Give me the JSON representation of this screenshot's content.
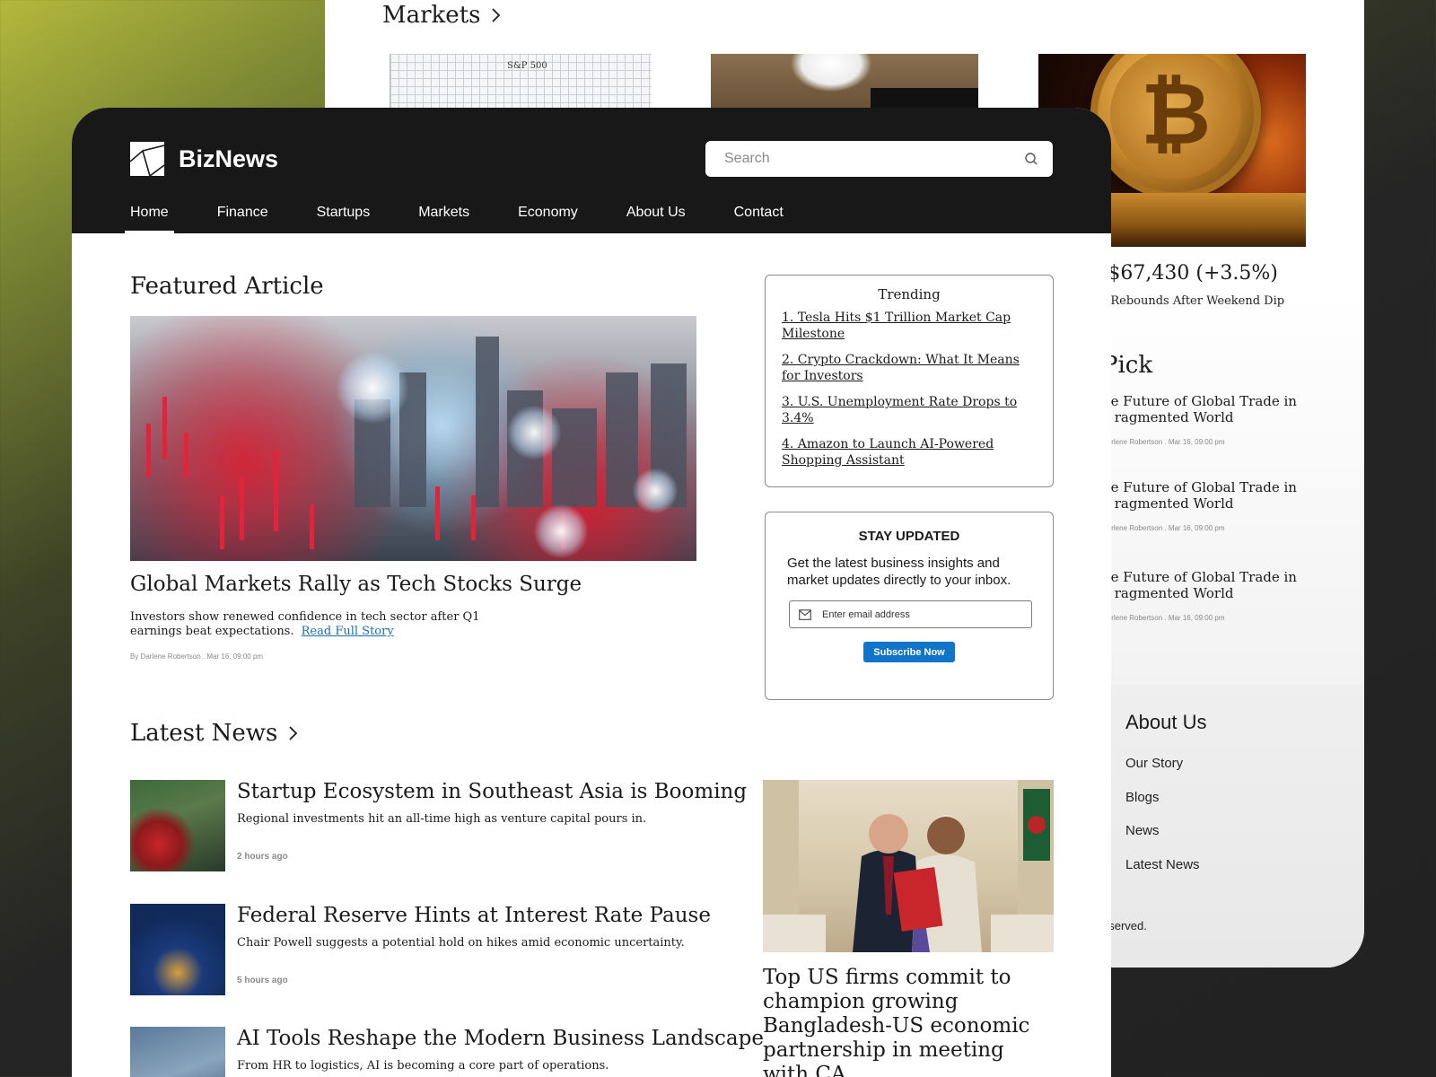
{
  "back": {
    "markets_heading": "Markets",
    "chart_label": "S&P 500",
    "price_text": ": $67,430 (+3.5%)",
    "price_sub": "t Rebounds After Weekend Dip",
    "pick_heading": "Pick",
    "picks": [
      {
        "title": "he Future of Global Trade in a ragmented World",
        "meta": "Darlene Robertson  . Mar 16, 09:00 pm"
      },
      {
        "title": "he Future of Global Trade in a ragmented World",
        "meta": "Darlene Robertson  . Mar 16, 09:00 pm"
      },
      {
        "title": "he Future of Global Trade in a ragmented World",
        "meta": "Darlene Robertson  . Mar 16, 09:00 pm"
      }
    ],
    "footer": {
      "about_title": "About Us",
      "links": [
        "Our Story",
        "Blogs",
        "News",
        "Latest News"
      ],
      "copyright": "eserved."
    }
  },
  "header": {
    "brand": "BizNews",
    "search_placeholder": "Search",
    "nav": [
      "Home",
      "Finance",
      "Startups",
      "Markets",
      "Economy",
      "About Us",
      "Contact"
    ],
    "active_nav": "Home"
  },
  "featured": {
    "heading": "Featured Article",
    "title": "Global Markets Rally as Tech Stocks Surge",
    "description": "Investors show renewed confidence in tech sector after Q1 earnings beat expectations.",
    "link": "Read Full Story",
    "meta": "By Darlene Robertson  . Mar 16, 09:00 pm"
  },
  "trending": {
    "title": "Trending",
    "items": [
      "1. Tesla Hits $1 Trillion Market Cap Milestone",
      "2. Crypto Crackdown: What It Means for Investors",
      "3. U.S. Unemployment Rate Drops to 3.4%",
      "4. Amazon to Launch AI-Powered Shopping Assistant"
    ]
  },
  "subscribe": {
    "title": "STAY UPDATED",
    "description": "Get the latest business insights and market updates directly to your inbox.",
    "email_placeholder": "Enter email address",
    "button": "Subscribe Now"
  },
  "latest": {
    "heading": "Latest News",
    "items": [
      {
        "title": "Startup Ecosystem in Southeast Asia is Booming",
        "desc": "Regional investments hit an all-time high as venture capital pours in.",
        "time": "2 hours ago"
      },
      {
        "title": "Federal Reserve Hints at Interest Rate Pause",
        "desc": "Chair Powell suggests a potential hold on hikes amid economic uncertainty.",
        "time": "5 hours ago"
      },
      {
        "title": "AI Tools Reshape the Modern Business Landscape",
        "desc": "From HR to logistics, AI is becoming a core part of operations.",
        "time": ""
      }
    ],
    "side_caption": "Top US firms commit to champion growing Bangladesh-US economic partnership in meeting with CA"
  },
  "colors": {
    "header_bg": "#181818",
    "accent_blue": "#1274c8",
    "link_blue": "#1a6fb0"
  }
}
